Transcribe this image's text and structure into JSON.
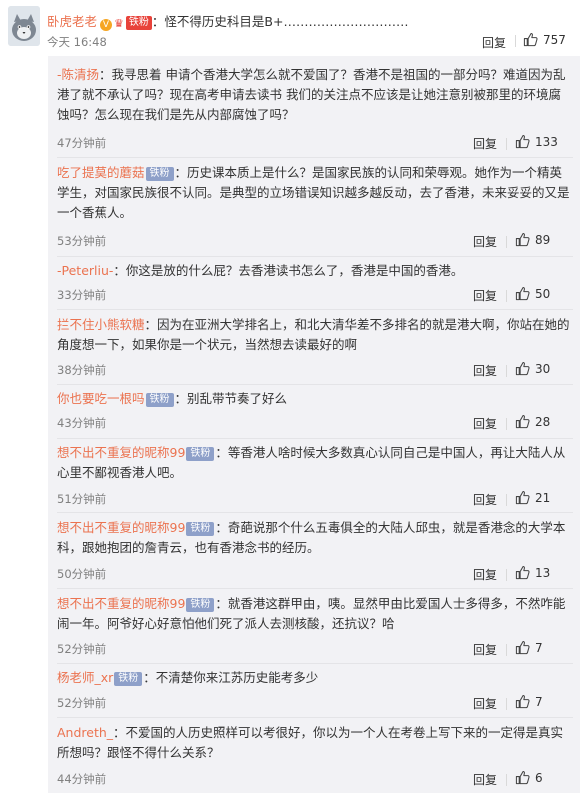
{
  "main_comment": {
    "username": "卧虎老老",
    "vip_badge": "V",
    "fan_badge": "铁粉",
    "text": "：怪不得历史科目是B+…………………………",
    "time": "今天 16:48",
    "reply_label": "回复",
    "likes": "757"
  },
  "replies": [
    {
      "username": "-陈清扬",
      "badge": "",
      "text": "：我寻思着 申请个香港大学怎么就不爱国了？香港不是祖国的一部分吗？难道因为乱港了就不承认了吗？现在高考申请去读书 我们的关注点不应该是让她注意别被那里的环境腐蚀吗？怎么现在我们是先从内部腐蚀了吗？",
      "time": "47分钟前",
      "reply_label": "回复",
      "likes": "133"
    },
    {
      "username": "吃了提莫的蘑菇",
      "badge": "铁粉",
      "text": "：历史课本质上是什么？是国家民族的认同和荣辱观。她作为一个精英学生，对国家民族很不认同。是典型的立场错误知识越多越反动，去了香港，未来妥妥的又是一个香蕉人。",
      "time": "53分钟前",
      "reply_label": "回复",
      "likes": "89"
    },
    {
      "username": "-Peterliu-",
      "badge": "",
      "text": "：你这是放的什么屁？去香港读书怎么了，香港是中国的香港。",
      "time": "33分钟前",
      "reply_label": "回复",
      "likes": "50"
    },
    {
      "username": "拦不住小熊软糖",
      "badge": "",
      "text": "：因为在亚洲大学排名上，和北大清华差不多排名的就是港大啊，你站在她的角度想一下，如果你是一个状元，当然想去读最好的啊",
      "time": "38分钟前",
      "reply_label": "回复",
      "likes": "30"
    },
    {
      "username": "你也要吃一根吗",
      "badge": "铁粉",
      "text": "：别乱带节奏了好么",
      "time": "43分钟前",
      "reply_label": "回复",
      "likes": "28"
    },
    {
      "username": "想不出不重复的昵称99",
      "badge": "铁粉",
      "text": "：等香港人啥时候大多数真心认同自己是中国人，再让大陆人从心里不鄙视香港人吧。",
      "time": "51分钟前",
      "reply_label": "回复",
      "likes": "21"
    },
    {
      "username": "想不出不重复的昵称99",
      "badge": "铁粉",
      "text": "：奇葩说那个什么五毒俱全的大陆人邱虫，就是香港念的大学本科，跟她抱团的詹青云，也有香港念书的经历。",
      "time": "50分钟前",
      "reply_label": "回复",
      "likes": "13"
    },
    {
      "username": "想不出不重复的昵称99",
      "badge": "铁粉",
      "text": "：就香港这群甲由，咦。显然甲由比爱国人士多得多，不然咋能闹一年。阿爷好心好意怕他们死了派人去测核酸，还抗议？哈",
      "time": "52分钟前",
      "reply_label": "回复",
      "likes": "7"
    },
    {
      "username": "杨老师_xr",
      "badge": "铁粉",
      "text": "：不清楚你来江苏历史能考多少",
      "time": "52分钟前",
      "reply_label": "回复",
      "likes": "7"
    },
    {
      "username": "Andreth_",
      "badge": "",
      "text": "：不爱国的人历史照样可以考很好，你以为一个人在考卷上写下来的一定得是真实所想吗？跟怪不得什么关系？",
      "time": "44分钟前",
      "reply_label": "回复",
      "likes": "6"
    }
  ]
}
